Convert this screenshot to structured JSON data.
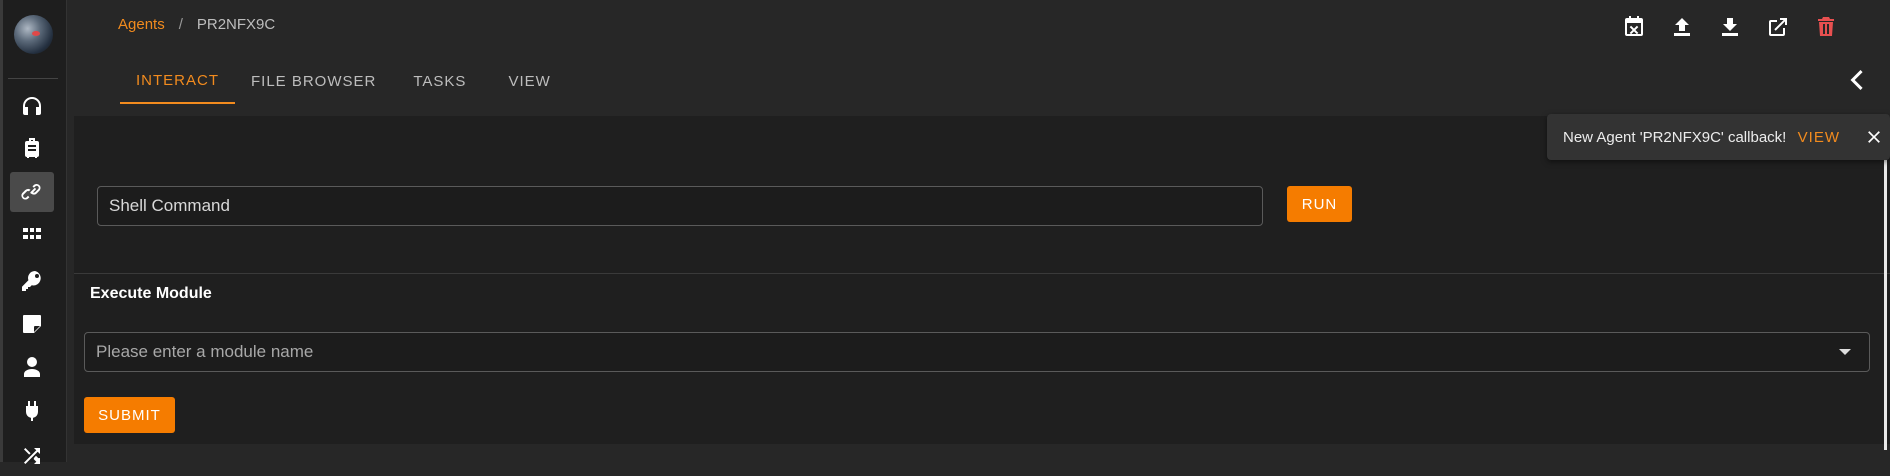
{
  "sidebar": {
    "logo_name": "globe-logo",
    "items": [
      {
        "icon": "headphones-icon",
        "active": false
      },
      {
        "icon": "luggage-icon",
        "active": false
      },
      {
        "icon": "link-icon",
        "active": true
      },
      {
        "icon": "grid-apps-icon",
        "active": false
      },
      {
        "icon": "key-icon",
        "active": false
      },
      {
        "icon": "sticky-note-icon",
        "active": false
      },
      {
        "icon": "person-icon",
        "active": false
      },
      {
        "icon": "plug-icon",
        "active": false
      },
      {
        "icon": "shuffle-icon",
        "active": false
      }
    ]
  },
  "breadcrumb": {
    "parent": "Agents",
    "separator": "/",
    "current": "PR2NFX9C"
  },
  "toolbar": {
    "icons": [
      "calendar-remove-icon",
      "upload-icon",
      "download-icon",
      "open-external-icon",
      "delete-icon"
    ]
  },
  "tabs": [
    {
      "label": "INTERACT",
      "active": true
    },
    {
      "label": "FILE BROWSER",
      "active": false
    },
    {
      "label": "TASKS",
      "active": false
    },
    {
      "label": "VIEW",
      "active": false
    }
  ],
  "shell": {
    "value": "Shell Command",
    "run_label": "RUN"
  },
  "module": {
    "title": "Execute Module",
    "placeholder": "Please enter a module name",
    "submit_label": "SUBMIT"
  },
  "toast": {
    "message": "New Agent 'PR2NFX9C' callback!",
    "action_label": "VIEW"
  },
  "colors": {
    "accent": "#f57c00",
    "link": "#f28b1e",
    "danger": "#e85050",
    "background": "#272727",
    "panel": "#1f1f1f"
  }
}
